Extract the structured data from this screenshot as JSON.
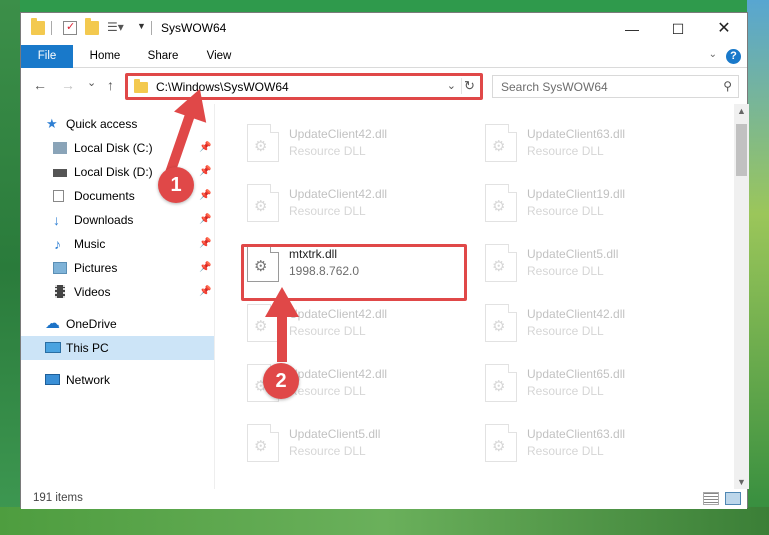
{
  "window": {
    "title": "SysWOW64"
  },
  "ribbon": {
    "tabs": [
      "File",
      "Home",
      "Share",
      "View"
    ]
  },
  "navigation": {
    "back": "←",
    "forward": "→",
    "recent": "⌄",
    "up": "↑",
    "address": "C:\\Windows\\SysWOW64",
    "search_placeholder": "Search SysWOW64"
  },
  "sidebar": {
    "items": [
      {
        "label": "Quick access",
        "icon": "star-icon",
        "pinned": false
      },
      {
        "label": "Local Disk (C:)",
        "icon": "drive-icon",
        "pinned": true
      },
      {
        "label": "Local Disk (D:)",
        "icon": "drive-icon",
        "pinned": true
      },
      {
        "label": "Documents",
        "icon": "documents-icon",
        "pinned": true
      },
      {
        "label": "Downloads",
        "icon": "download-icon",
        "pinned": true
      },
      {
        "label": "Music",
        "icon": "music-icon",
        "pinned": true
      },
      {
        "label": "Pictures",
        "icon": "pictures-icon",
        "pinned": true
      },
      {
        "label": "Videos",
        "icon": "videos-icon",
        "pinned": true
      },
      {
        "label": "OneDrive",
        "icon": "cloud-icon",
        "pinned": false
      },
      {
        "label": "This PC",
        "icon": "computer-icon",
        "pinned": false,
        "selected": true
      },
      {
        "label": "Network",
        "icon": "network-icon",
        "pinned": false
      }
    ]
  },
  "files": [
    {
      "name": "UpdateClient42.dll",
      "sub": "Resource DLL",
      "faded": true
    },
    {
      "name": "UpdateClient63.dll",
      "sub": "Resource DLL",
      "faded": true
    },
    {
      "name": "UpdateClient42.dll",
      "sub": "Resource DLL",
      "faded": true
    },
    {
      "name": "UpdateClient19.dll",
      "sub": "Resource DLL",
      "faded": true
    },
    {
      "name": "mtxtrk.dll",
      "sub": "1998.8.762.0",
      "faded": false
    },
    {
      "name": "UpdateClient5.dll",
      "sub": "Resource DLL",
      "faded": true
    },
    {
      "name": "UpdateClient42.dll",
      "sub": "Resource DLL",
      "faded": true
    },
    {
      "name": "UpdateClient42.dll",
      "sub": "Resource DLL",
      "faded": true
    },
    {
      "name": "UpdateClient42.dll",
      "sub": "Resource DLL",
      "faded": true
    },
    {
      "name": "UpdateClient65.dll",
      "sub": "Resource DLL",
      "faded": true
    },
    {
      "name": "UpdateClient5.dll",
      "sub": "Resource DLL",
      "faded": true
    },
    {
      "name": "UpdateClient63.dll",
      "sub": "Resource DLL",
      "faded": true
    }
  ],
  "status": {
    "count": "191 items"
  },
  "annotations": {
    "step1": "1",
    "step2": "2",
    "color": "#e04848"
  }
}
